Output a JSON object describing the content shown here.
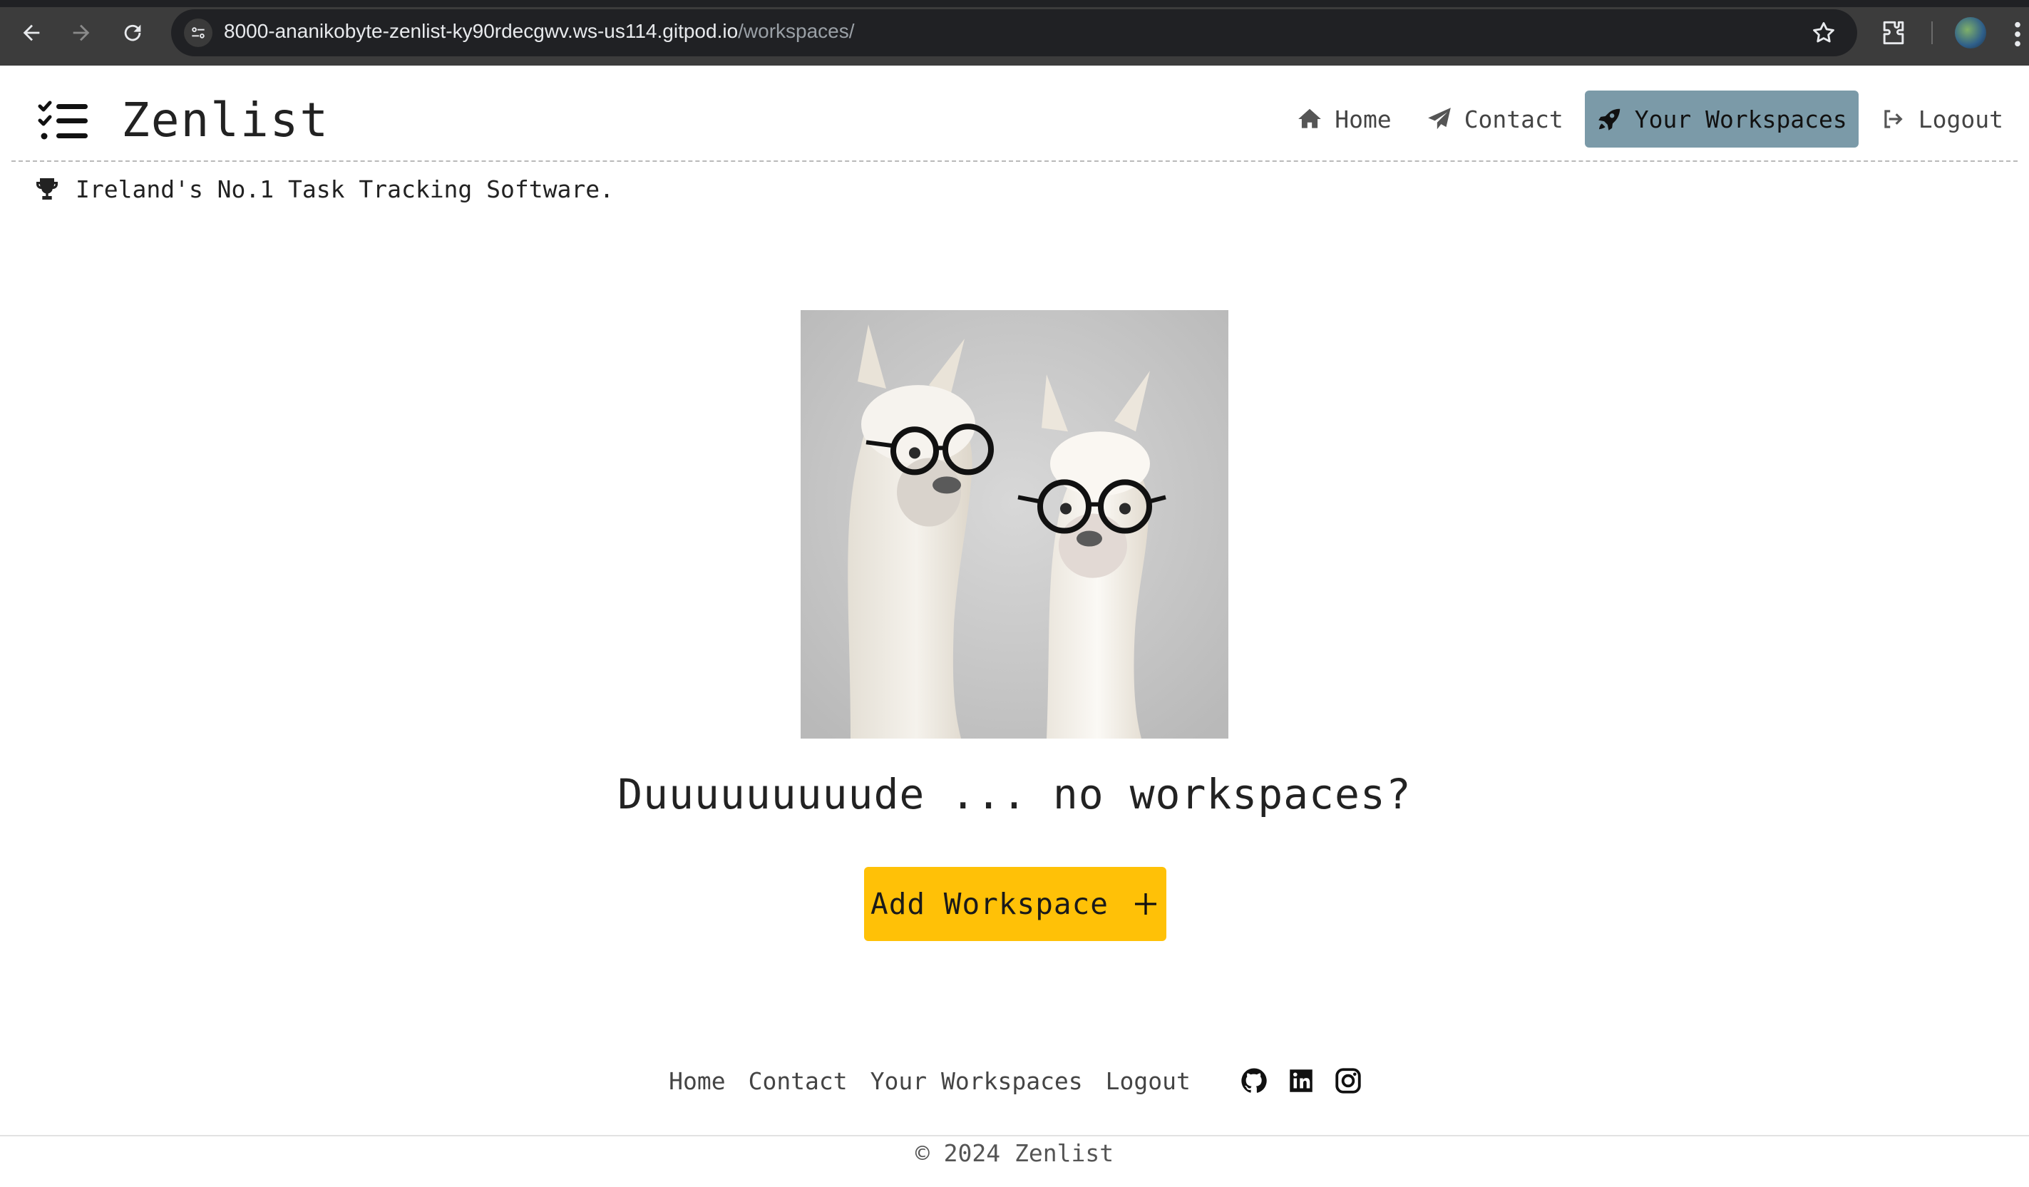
{
  "browser": {
    "url_host": "8000-ananikobyte-zenlist-ky90rdecgwv.ws-us114.gitpod.io",
    "url_path": "/workspaces/",
    "icons": [
      "back-arrow-icon",
      "forward-arrow-icon",
      "reload-icon",
      "site-settings-icon",
      "bookmark-star-icon",
      "extensions-icon",
      "profile-avatar",
      "menu-dots-icon"
    ]
  },
  "header": {
    "brand_name": "Zenlist",
    "brand_icon": "checklist-icon",
    "nav": [
      {
        "label": "Home",
        "icon": "home-icon"
      },
      {
        "label": "Contact",
        "icon": "paper-plane-icon"
      },
      {
        "label": "Your Workspaces",
        "icon": "rocket-icon",
        "active": true
      },
      {
        "label": "Logout",
        "icon": "logout-icon"
      }
    ],
    "active_color": "#7b9aa8"
  },
  "tagline": {
    "text": "Ireland's No.1 Task Tracking Software.",
    "icon": "trophy-icon"
  },
  "main": {
    "image": "two-llamas-with-glasses-image",
    "empty_title": "Duuuuuuuuude ... no workspaces?",
    "add_button_label": "Add Workspace",
    "add_button_icon": "plus-icon",
    "add_button_color": "#ffc107"
  },
  "footer": {
    "links": [
      "Home",
      "Contact",
      "Your Workspaces",
      "Logout"
    ],
    "social_icons": [
      "github-icon",
      "linkedin-icon",
      "instagram-icon"
    ],
    "copyright": "© 2024 Zenlist"
  }
}
